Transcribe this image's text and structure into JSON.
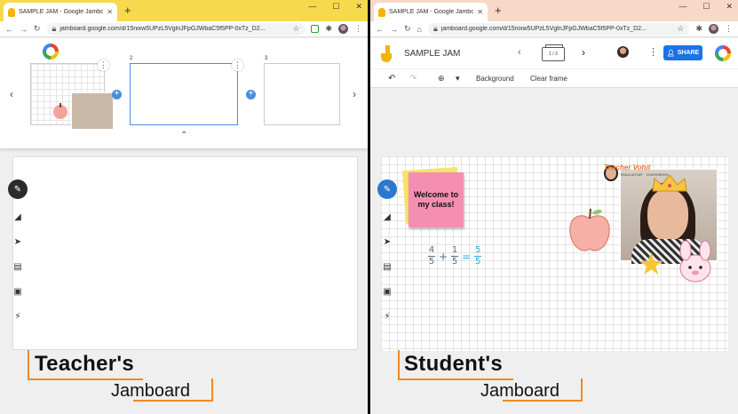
{
  "left_window": {
    "tab_title": "SAMPLE JAM - Google Jamboard",
    "url": "jamboard.google.com/d/15nixw5UPzL5VglnJFpGJWbaC5f5PP-0xTz_D2...",
    "frame_numbers": [
      "2",
      "3"
    ],
    "caption_main": "Teacher's",
    "caption_sub": "Jamboard"
  },
  "right_window": {
    "tab_title": "SAMPLE JAM - Google Jamboard",
    "url": "jamboard.google.com/d/15nixw5UPzL5VglnJFpGJWbaC5f5PP-0xTz_D2...",
    "jam_title": "SAMPLE JAM",
    "frame_indicator": "1 / 3",
    "share_label": "SHARE",
    "background_label": "Background",
    "clear_frame_label": "Clear frame",
    "sticky_text": "Welcome to my class!",
    "equation": {
      "a_num": "4",
      "a_den": "5",
      "op_plus": "+",
      "b_num": "1",
      "b_den": "5",
      "op_eq": "=",
      "c_num": "5",
      "c_den": "5"
    },
    "banner": "Teacher Vohit",
    "banner_sub": "EDUCATOR · OVERSEER",
    "caption_main": "Student's",
    "caption_sub": "Jamboard"
  },
  "colors": {
    "left_tabstrip": "#f6d94c",
    "right_tabstrip": "#f8d9c8",
    "pen_tool_active": "#2b78d0",
    "caption_bracket": "#f08a24",
    "share_button": "#1a73e8",
    "sticky_note": "#f48fb1"
  },
  "icons": {
    "tools": [
      "pen-icon",
      "eraser-icon",
      "select-icon",
      "sticky-note-icon",
      "image-icon",
      "laser-icon"
    ]
  }
}
